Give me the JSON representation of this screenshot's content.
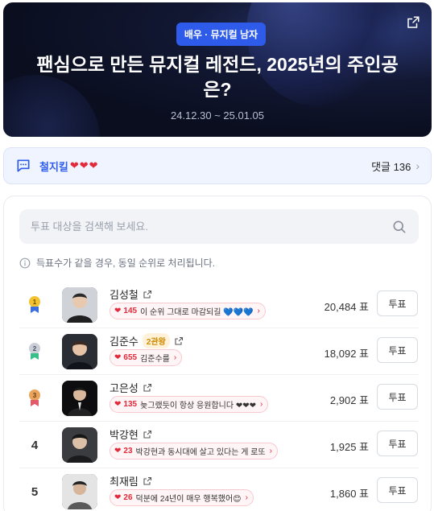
{
  "banner": {
    "category_badge": "배우 · 뮤지컬 남자",
    "title": "팬심으로 만든 뮤지컬 레전드, 2025년의 주인공은?",
    "date_range": "24.12.30 ~ 25.01.05",
    "share_icon": "share-external-icon"
  },
  "comment_strip": {
    "icon": "chat-bubble-icon",
    "author": "철지킬",
    "hearts": "❤❤❤",
    "count_label": "댓글 136",
    "chevron": "›"
  },
  "search": {
    "placeholder": "투표 대상을 검색해 보세요.",
    "value": ""
  },
  "notice": "득표수가 같을 경우, 동일 순위로 처리됩니다.",
  "colors": {
    "accent": "#2f5bea",
    "heart": "#e22a3a",
    "gold": "#f2c230",
    "silver": "#c9ced8",
    "bronze": "#e8a45c"
  },
  "rankings": [
    {
      "rank": "1",
      "medal": "gold",
      "name": "김성철",
      "badge": "",
      "cheer_count": "145",
      "cheer_text": "이 순위 그대로 마감되길 💙💙💙",
      "votes": "20,484 표",
      "vote_label": "투표"
    },
    {
      "rank": "2",
      "medal": "silver",
      "name": "김준수",
      "badge": "2관왕",
      "cheer_count": "655",
      "cheer_text": "김준수를",
      "votes": "18,092 표",
      "vote_label": "투표"
    },
    {
      "rank": "3",
      "medal": "bronze",
      "name": "고은성",
      "badge": "",
      "cheer_count": "135",
      "cheer_text": "늦그랬듯이 항상 응원합니다 ❤❤❤",
      "votes": "2,902 표",
      "vote_label": "투표"
    },
    {
      "rank": "4",
      "medal": "",
      "name": "박강현",
      "badge": "",
      "cheer_count": "23",
      "cheer_text": "박강현과 동시대에 살고 있다는 게 로또",
      "votes": "1,925 표",
      "vote_label": "투표"
    },
    {
      "rank": "5",
      "medal": "",
      "name": "최재림",
      "badge": "",
      "cheer_count": "26",
      "cheer_text": "덕분에 24년이 매우 행복했어😊",
      "votes": "1,860 표",
      "vote_label": "투표"
    }
  ]
}
